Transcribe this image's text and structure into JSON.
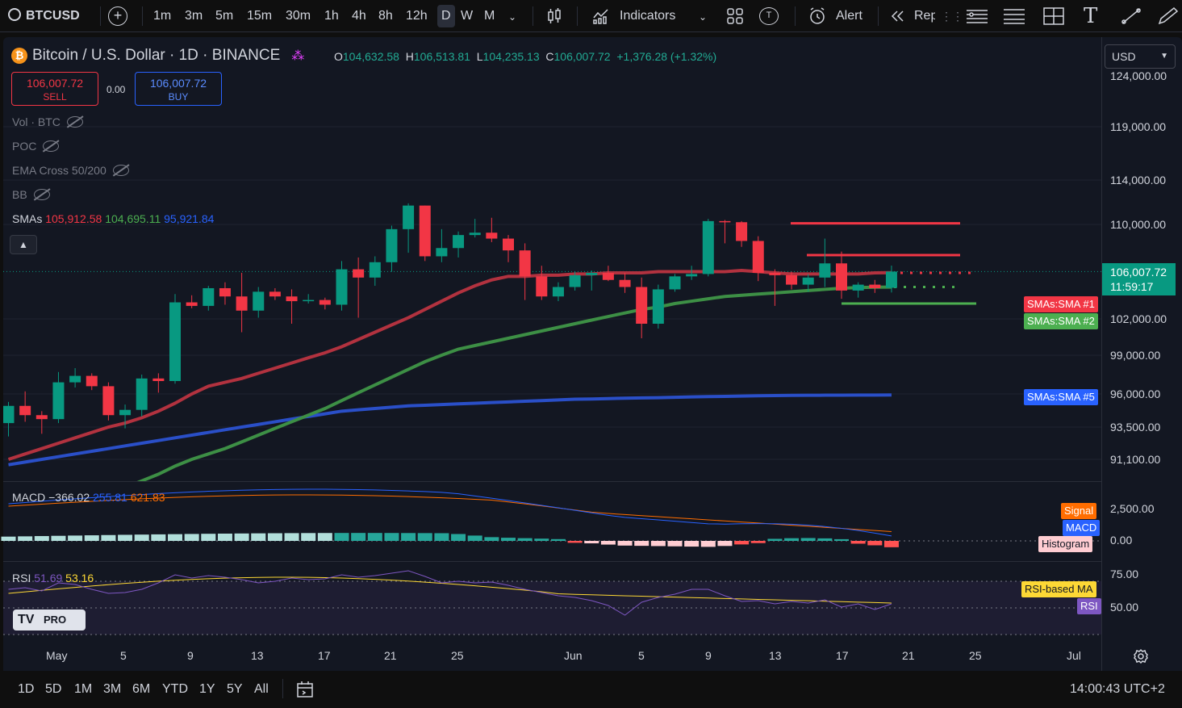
{
  "toolbar": {
    "symbol": "BTCUSD",
    "timeframes": [
      "1m",
      "3m",
      "5m",
      "15m",
      "30m",
      "1h",
      "4h",
      "8h",
      "12h",
      "D",
      "W",
      "M"
    ],
    "active_timeframe": "D",
    "indicators_label": "Indicators",
    "alert_label": "Alert",
    "replay_label": "Rep",
    "t_badge": "T"
  },
  "legend": {
    "title": "Bitcoin / U.S. Dollar · 1D · BINANCE",
    "o_key": "O",
    "o": "104,632.58",
    "h_key": "H",
    "h": "106,513.81",
    "l_key": "L",
    "l": "104,235.13",
    "c_key": "C",
    "c": "106,007.72",
    "change": "+1,376.28 (+1.32%)",
    "sell_price": "106,007.72",
    "sell_label": "SELL",
    "buy_price": "106,007.72",
    "buy_label": "BUY",
    "spread": "0.00",
    "indicators": [
      "Vol · BTC",
      "POC",
      "EMA Cross 50/200",
      "BB"
    ],
    "sma_label": "SMAs",
    "sma1": "105,912.58",
    "sma2": "104,695.11",
    "sma3": "95,921.84"
  },
  "currency": "USD",
  "price_axis": [
    "124,000.00",
    "119,000.00",
    "114,000.00",
    "110,000.00",
    "102,000.00",
    "99,000.00",
    "96,000.00",
    "93,500.00",
    "91,100.00"
  ],
  "current_price": {
    "price": "106,007.72",
    "countdown": "11:59:17"
  },
  "tags": {
    "sma1": "SMAs:SMA #1",
    "sma2": "SMAs:SMA #2",
    "sma5": "SMAs:SMA #5",
    "signal": "Signal",
    "macd": "MACD",
    "histogram": "Histogram",
    "rsi_ma": "RSI-based MA",
    "rsi": "RSI"
  },
  "macd": {
    "label": "MACD",
    "v1": "−366.02",
    "v2": "255.81",
    "v3": "621.83",
    "axis": [
      "2,500.00",
      "0.00"
    ]
  },
  "rsi": {
    "label": "RSI",
    "v1": "51.69",
    "v2": "53.16",
    "axis": [
      "75.00",
      "50.00"
    ]
  },
  "tv_logo": "PRO",
  "x_axis": [
    "May",
    "5",
    "9",
    "13",
    "17",
    "21",
    "25",
    "Jun",
    "5",
    "9",
    "13",
    "17",
    "21",
    "25",
    "Jul"
  ],
  "ranges": [
    "1D",
    "5D",
    "1M",
    "3M",
    "6M",
    "YTD",
    "1Y",
    "5Y",
    "All"
  ],
  "clock": "14:00:43 UTC+2",
  "colors": {
    "up": "#089981",
    "down": "#f23645",
    "sma1": "#b2323f",
    "sma2": "#3d8f45",
    "sma5": "#2a4fc8",
    "macd": "#2962ff",
    "signal": "#ff6d00",
    "rsi": "#7e57c2",
    "rsi_ma": "#fdd835"
  },
  "chart_data": {
    "type": "candlestick",
    "candles": [
      {
        "o": 93800,
        "h": 95400,
        "l": 92800,
        "c": 95100
      },
      {
        "o": 95100,
        "h": 96200,
        "l": 93900,
        "c": 94400
      },
      {
        "o": 94400,
        "h": 94700,
        "l": 93000,
        "c": 94100
      },
      {
        "o": 94100,
        "h": 97700,
        "l": 93800,
        "c": 96900
      },
      {
        "o": 96900,
        "h": 98000,
        "l": 96500,
        "c": 97400
      },
      {
        "o": 97400,
        "h": 97600,
        "l": 96300,
        "c": 96600
      },
      {
        "o": 96600,
        "h": 96900,
        "l": 94000,
        "c": 94400
      },
      {
        "o": 94400,
        "h": 95200,
        "l": 93400,
        "c": 94800
      },
      {
        "o": 94800,
        "h": 97500,
        "l": 94300,
        "c": 97200
      },
      {
        "o": 97200,
        "h": 97600,
        "l": 96100,
        "c": 97000
      },
      {
        "o": 97000,
        "h": 104100,
        "l": 96800,
        "c": 103400
      },
      {
        "o": 103400,
        "h": 104000,
        "l": 102900,
        "c": 103100
      },
      {
        "o": 103100,
        "h": 104800,
        "l": 102700,
        "c": 104600
      },
      {
        "o": 104600,
        "h": 105100,
        "l": 103200,
        "c": 103900
      },
      {
        "o": 103900,
        "h": 105900,
        "l": 100900,
        "c": 102700
      },
      {
        "o": 102700,
        "h": 104700,
        "l": 102100,
        "c": 104300
      },
      {
        "o": 104300,
        "h": 104600,
        "l": 103600,
        "c": 103900
      },
      {
        "o": 103900,
        "h": 104500,
        "l": 101600,
        "c": 103500
      },
      {
        "o": 103500,
        "h": 104100,
        "l": 103300,
        "c": 103600
      },
      {
        "o": 103600,
        "h": 103800,
        "l": 102800,
        "c": 103200
      },
      {
        "o": 103200,
        "h": 106900,
        "l": 102700,
        "c": 106200
      },
      {
        "o": 106200,
        "h": 107200,
        "l": 102100,
        "c": 105500
      },
      {
        "o": 105500,
        "h": 107300,
        "l": 104800,
        "c": 106800
      },
      {
        "o": 106800,
        "h": 109900,
        "l": 106000,
        "c": 109600
      },
      {
        "o": 109600,
        "h": 111900,
        "l": 107600,
        "c": 111700
      },
      {
        "o": 111700,
        "h": 111700,
        "l": 106900,
        "c": 107300
      },
      {
        "o": 107300,
        "h": 109600,
        "l": 106800,
        "c": 108000
      },
      {
        "o": 108000,
        "h": 109400,
        "l": 107200,
        "c": 109100
      },
      {
        "o": 109100,
        "h": 110500,
        "l": 108900,
        "c": 109300
      },
      {
        "o": 109300,
        "h": 110600,
        "l": 108500,
        "c": 108800
      },
      {
        "o": 108800,
        "h": 109100,
        "l": 106800,
        "c": 107800
      },
      {
        "o": 107800,
        "h": 108400,
        "l": 103600,
        "c": 105600
      },
      {
        "o": 105600,
        "h": 106500,
        "l": 103600,
        "c": 103900
      },
      {
        "o": 103900,
        "h": 105100,
        "l": 103500,
        "c": 104700
      },
      {
        "o": 104700,
        "h": 106000,
        "l": 104400,
        "c": 105700
      },
      {
        "o": 105700,
        "h": 106100,
        "l": 104400,
        "c": 105900
      },
      {
        "o": 105900,
        "h": 106500,
        "l": 105200,
        "c": 105300
      },
      {
        "o": 105300,
        "h": 105900,
        "l": 104200,
        "c": 104700
      },
      {
        "o": 104700,
        "h": 105500,
        "l": 100400,
        "c": 101600
      },
      {
        "o": 101600,
        "h": 104900,
        "l": 101200,
        "c": 104500
      },
      {
        "o": 104500,
        "h": 105800,
        "l": 104300,
        "c": 105600
      },
      {
        "o": 105600,
        "h": 106500,
        "l": 105300,
        "c": 105800
      },
      {
        "o": 105800,
        "h": 110500,
        "l": 105600,
        "c": 110300
      },
      {
        "o": 110300,
        "h": 110400,
        "l": 108400,
        "c": 110200
      },
      {
        "o": 110200,
        "h": 110300,
        "l": 108100,
        "c": 108600
      },
      {
        "o": 108600,
        "h": 109000,
        "l": 105200,
        "c": 105900
      },
      {
        "o": 105900,
        "h": 106200,
        "l": 103100,
        "c": 105700
      },
      {
        "o": 105700,
        "h": 106000,
        "l": 104500,
        "c": 104900
      },
      {
        "o": 104900,
        "h": 105800,
        "l": 104300,
        "c": 105500
      },
      {
        "o": 105500,
        "h": 108800,
        "l": 104700,
        "c": 106700
      },
      {
        "o": 106700,
        "h": 107700,
        "l": 103700,
        "c": 104400
      },
      {
        "o": 104400,
        "h": 105100,
        "l": 103800,
        "c": 104900
      },
      {
        "o": 104900,
        "h": 105300,
        "l": 104200,
        "c": 104600
      },
      {
        "o": 104632.58,
        "h": 106513.81,
        "l": 104235.13,
        "c": 106007.72
      }
    ],
    "sma1": [
      91100,
      91500,
      91900,
      92300,
      92700,
      93100,
      93500,
      93800,
      94200,
      94700,
      95300,
      96000,
      96600,
      96900,
      97200,
      97600,
      98000,
      98400,
      98800,
      99200,
      99700,
      100300,
      100900,
      101500,
      102100,
      102800,
      103500,
      104200,
      104800,
      105300,
      105600,
      105600,
      105700,
      105700,
      105800,
      105800,
      105900,
      105900,
      105900,
      106000,
      106000,
      106000,
      106000,
      106000,
      106100,
      106000,
      105900,
      105800,
      105800,
      105800,
      105800,
      105800,
      105900,
      105912.58
    ],
    "sma2": [
      85000,
      85500,
      86000,
      86600,
      87200,
      87800,
      88400,
      89000,
      89500,
      90000,
      90600,
      91100,
      91500,
      91900,
      92400,
      92900,
      93400,
      93900,
      94400,
      94900,
      95500,
      96100,
      96700,
      97300,
      97900,
      98500,
      99000,
      99500,
      99800,
      100100,
      100400,
      100700,
      101000,
      101300,
      101600,
      101900,
      102200,
      102500,
      102800,
      103000,
      103300,
      103500,
      103700,
      103900,
      104000,
      104100,
      104200,
      104300,
      104400,
      104500,
      104600,
      104650,
      104680,
      104695.11
    ],
    "sma5": [
      90700,
      90900,
      91100,
      91300,
      91500,
      91700,
      91900,
      92100,
      92300,
      92500,
      92700,
      92900,
      93100,
      93300,
      93500,
      93700,
      93900,
      94100,
      94300,
      94500,
      94700,
      94800,
      94900,
      95000,
      95100,
      95150,
      95200,
      95250,
      95300,
      95350,
      95400,
      95450,
      95500,
      95550,
      95600,
      95620,
      95650,
      95680,
      95700,
      95720,
      95750,
      95780,
      95800,
      95820,
      95840,
      95860,
      95880,
      95890,
      95900,
      95905,
      95910,
      95915,
      95918,
      95921.84
    ],
    "levels": [
      {
        "price": 110100,
        "style": "solid",
        "color": "#f23645"
      },
      {
        "price": 107400,
        "style": "solid",
        "color": "#f23645"
      },
      {
        "price": 105900,
        "style": "dotted",
        "color": "#f23645"
      },
      {
        "price": 104700,
        "style": "dotted",
        "color": "#4caf50"
      },
      {
        "price": 103300,
        "style": "solid",
        "color": "#4caf50"
      }
    ],
    "rsi_ma_value": 53.16,
    "rsi_value": 51.69
  }
}
